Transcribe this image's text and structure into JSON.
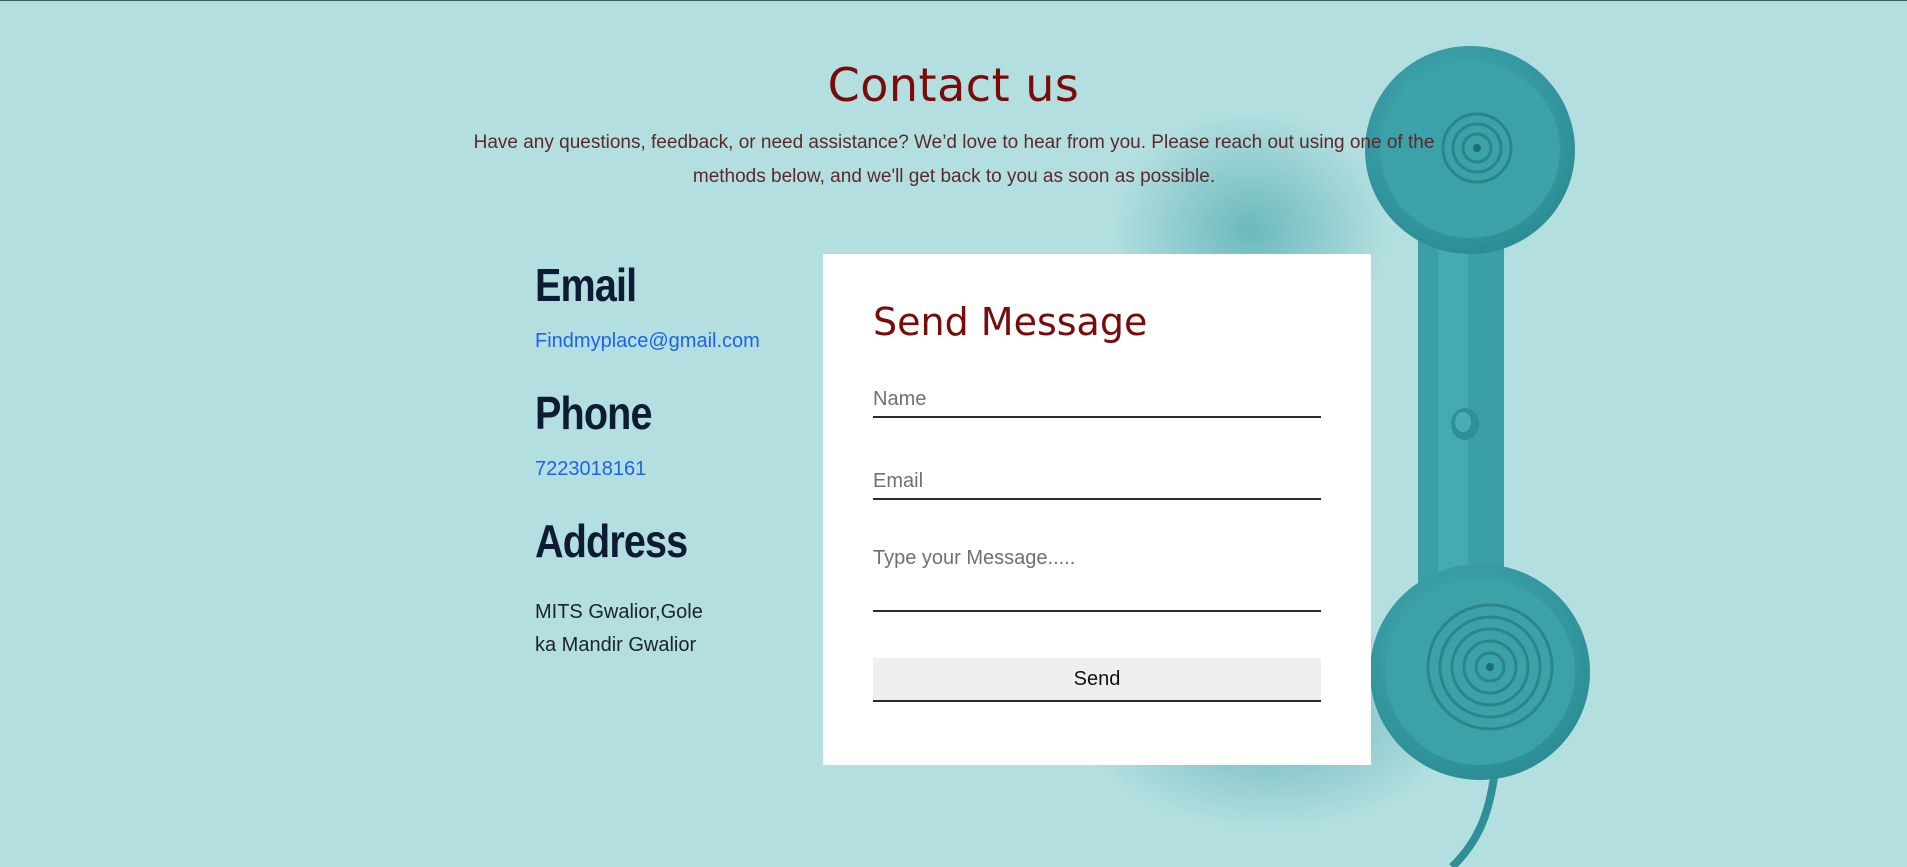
{
  "page": {
    "title": "Contact us",
    "intro": "Have any questions, feedback, or need assistance? We’d love to hear from you. Please reach out using one of the methods below, and we'll get back to you as soon as possible."
  },
  "contact_info": {
    "email_heading": "Email",
    "email_value": "Findmyplace@gmail.com",
    "phone_heading": "Phone",
    "phone_value": "7223018161",
    "address_heading": "Address",
    "address_value": "MITS Gwalior,Gole ka Mandir Gwalior"
  },
  "form": {
    "title": "Send Message",
    "name_placeholder": "Name",
    "email_placeholder": "Email",
    "message_placeholder": "Type your Message.....",
    "send_label": "Send"
  },
  "colors": {
    "background": "#b4dfe0",
    "title": "#7a0b0b",
    "heading": "#0d1b33",
    "link": "#1d63f0",
    "phone_illustration": "#3fa6ae"
  },
  "icons": {
    "decoration": "telephone-handset-illustration"
  }
}
